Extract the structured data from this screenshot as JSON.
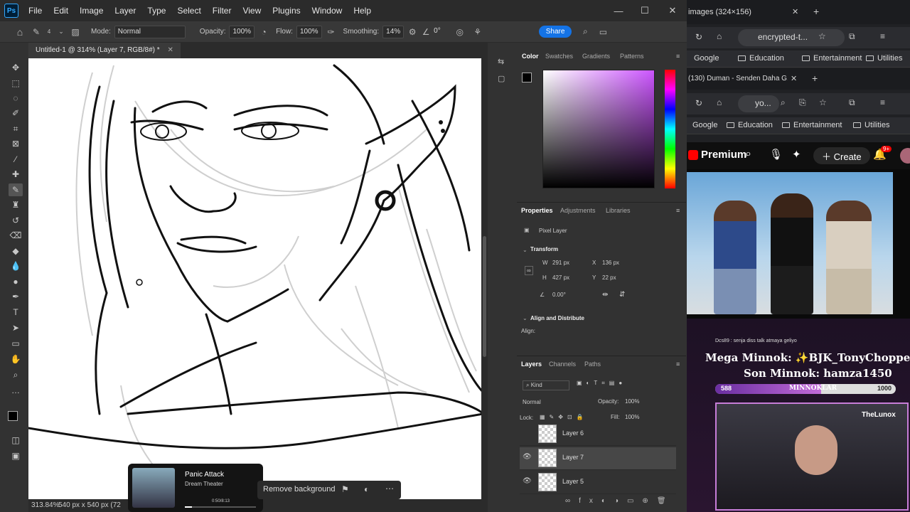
{
  "photoshop": {
    "logo": "Ps",
    "menu": [
      "File",
      "Edit",
      "Image",
      "Layer",
      "Type",
      "Select",
      "Filter",
      "View",
      "Plugins",
      "Window",
      "Help"
    ],
    "options": {
      "brush_size": "4",
      "mode_label": "Mode:",
      "mode_value": "Normal",
      "opacity_label": "Opacity:",
      "opacity_value": "100%",
      "flow_label": "Flow:",
      "flow_value": "100%",
      "smoothing_label": "Smoothing:",
      "smoothing_value": "14%",
      "angle_value": "0°",
      "share_label": "Share"
    },
    "doc_tab": "Untitled-1 @ 314% (Layer 7, RGB/8#) *",
    "status": {
      "zoom": "313.84%",
      "doc_size": "540 px x 540 px (72"
    },
    "color_panel": {
      "tabs": [
        "Color",
        "Swatches",
        "Gradients",
        "Patterns"
      ],
      "hue_color": "#cc55ff"
    },
    "properties": {
      "tabs": [
        "Properties",
        "Adjustments",
        "Libraries"
      ],
      "type": "Pixel Layer",
      "transform_title": "Transform",
      "w_label": "W",
      "w_value": "291 px",
      "x_label": "X",
      "x_value": "136 px",
      "h_label": "H",
      "h_value": "427 px",
      "y_label": "Y",
      "y_value": "22 px",
      "angle_value": "0.00°",
      "align_title": "Align and Distribute",
      "align_label": "Align:"
    },
    "layers": {
      "tabs": [
        "Layers",
        "Channels",
        "Paths"
      ],
      "filter": "Kind",
      "blend": "Normal",
      "opacity_label": "Opacity:",
      "opacity_value": "100%",
      "lock_label": "Lock:",
      "fill_label": "Fill:",
      "fill_value": "100%",
      "items": [
        {
          "name": "Layer 6",
          "visible": false,
          "selected": false
        },
        {
          "name": "Layer 7",
          "visible": true,
          "selected": true
        },
        {
          "name": "Layer 5",
          "visible": true,
          "selected": false
        }
      ]
    },
    "music": {
      "title": "Panic Attack",
      "artist": "Dream Theater",
      "time": "0:50/8:13",
      "progress": 0.1
    },
    "contextual": {
      "remove_bg": "Remove background"
    }
  },
  "browser": {
    "tab1_title": "images (324×156)",
    "address1": "encrypted-t...",
    "bookmarks1": [
      "Google",
      "Education",
      "Entertainment",
      "Utilities"
    ],
    "tab2_title": "(130) Duman - Senden Daha G...",
    "address2": "yo...",
    "bookmarks2": [
      "Google",
      "Education",
      "Entertainment",
      "Utilities"
    ],
    "youtube": {
      "logo_text": "Premium",
      "create_label": "Create",
      "notif_badge": "9+"
    },
    "stream": {
      "chat_line": "Dcs89 : senja diss talk atmaya geliyo",
      "mega_minnok": "Mega Minnok: ✨BJK_TonyChopper✨",
      "son_minnok": "Son Minnok: hamza1450",
      "bar_min": "588",
      "bar_label": "MINNOKLAR",
      "bar_max": "1000",
      "bar_fraction": 0.588,
      "cam_name": "TheLunox"
    }
  }
}
